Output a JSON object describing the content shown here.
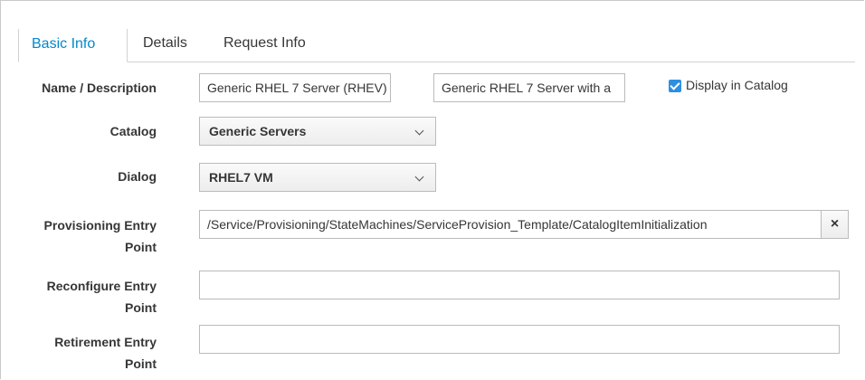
{
  "tabs": [
    {
      "label": "Basic Info",
      "active": true
    },
    {
      "label": "Details",
      "active": false
    },
    {
      "label": "Request Info",
      "active": false
    }
  ],
  "form": {
    "name_description": {
      "label": "Name / Description",
      "name_value": "Generic RHEL 7 Server (RHEV)",
      "description_value": "Generic RHEL 7 Server with a",
      "display_in_catalog_label": "Display in Catalog",
      "display_in_catalog_checked": true
    },
    "catalog": {
      "label": "Catalog",
      "selected": "Generic Servers"
    },
    "dialog": {
      "label": "Dialog",
      "selected": "RHEL7 VM"
    },
    "provisioning": {
      "label_line1": "Provisioning Entry",
      "label_line2": "Point",
      "value": "/Service/Provisioning/StateMachines/ServiceProvision_Template/CatalogItemInitialization",
      "clear_symbol": "×"
    },
    "reconfigure": {
      "label_line1": "Reconfigure Entry",
      "label_line2": "Point",
      "value": ""
    },
    "retirement": {
      "label_line1": "Retirement Entry",
      "label_line2": "Point",
      "value": ""
    }
  },
  "colors": {
    "accent": "#0088ce",
    "checkbox": "#2d8fe0"
  },
  "icons": {
    "select_arrow": "chevron-down-icon",
    "clear": "close-icon",
    "checkbox": "checkmark-icon"
  }
}
